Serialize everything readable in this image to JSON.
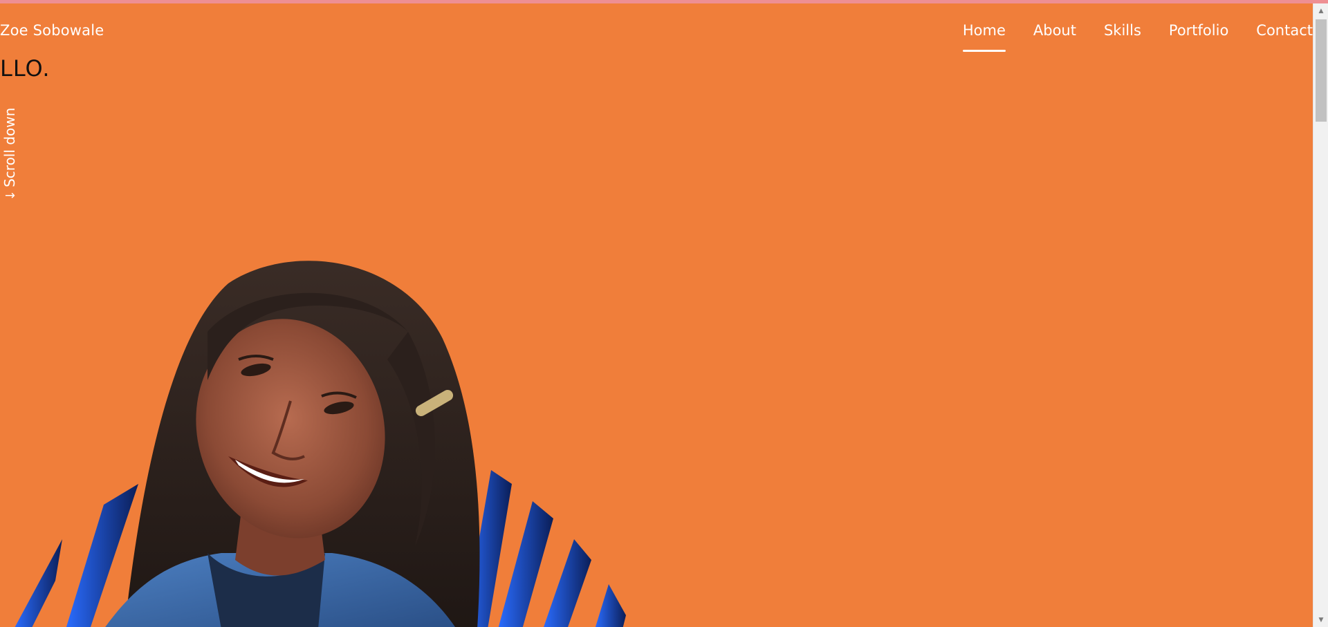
{
  "header": {
    "site_name": "Zoe Sobowale",
    "nav": [
      {
        "label": "Home",
        "active": true
      },
      {
        "label": "About",
        "active": false
      },
      {
        "label": "Skills",
        "active": false
      },
      {
        "label": "Portfolio",
        "active": false
      },
      {
        "label": "Contact",
        "active": false
      }
    ]
  },
  "hero": {
    "greeting_fragment": "LLO.",
    "scroll_label": "Scroll down",
    "scroll_icon": "arrow-down-icon",
    "background_color": "#f07e3a",
    "accent_stripe_color": "#2563eb"
  },
  "browser": {
    "top_strip_color": "#ee8f93",
    "scrollbar_thumb_color": "#c1c1c1"
  }
}
